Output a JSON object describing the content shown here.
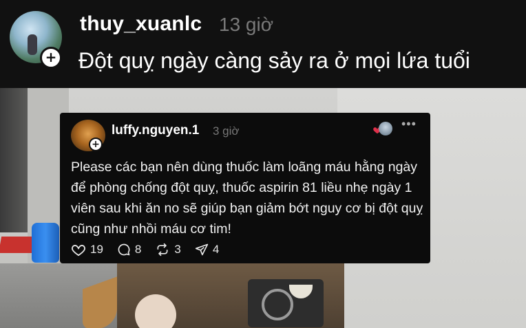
{
  "top_post": {
    "username": "thuy_xuanlc",
    "time": "13 giờ",
    "text": "Đột quỵ ngày càng sảy ra ở mọi lứa tuổi",
    "follow_symbol": "+"
  },
  "reply": {
    "username": "luffy.nguyen.1",
    "time": "3 giờ",
    "follow_symbol": "+",
    "more_symbol": "•••",
    "body": "Please các bạn nên dùng thuốc làm loãng máu hằng ngày để phòng chống đột quỵ, thuốc aspirin 81 liều nhẹ ngày 1 viên sau khi ăn no sẽ giúp bạn giảm bớt nguy cơ bị đột quỵ cũng như nhồi máu cơ tim!",
    "likes": "19",
    "comments": "8",
    "reposts": "3",
    "shares": "4",
    "icons": [
      "heart-icon",
      "comment-icon",
      "repost-icon",
      "share-icon",
      "more-icon"
    ],
    "accent_color": "#e0304a"
  }
}
